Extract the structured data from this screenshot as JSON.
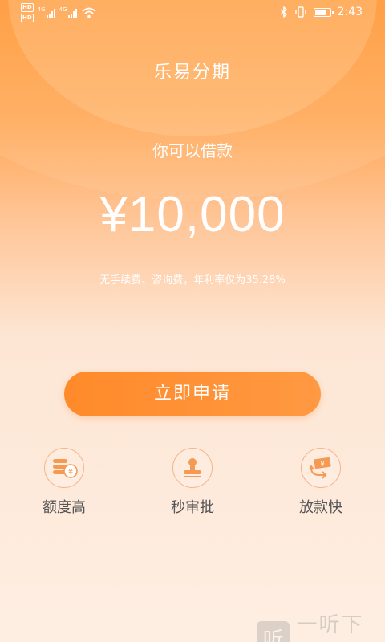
{
  "status_bar": {
    "hd_badge_1": "HD",
    "hd_badge_2": "HD",
    "signal_1_label": "4G",
    "signal_2_label": "4G",
    "time": "2:43",
    "battery_level": 0.75
  },
  "app": {
    "title": "乐易分期"
  },
  "loan": {
    "label": "你可以借款",
    "amount": "¥10,000",
    "fee_note": "无手续费、咨询费，年利率仅为35.28%"
  },
  "apply_button": {
    "label": "立即申请"
  },
  "features": [
    {
      "label": "额度高",
      "icon": "coins-icon"
    },
    {
      "label": "秒审批",
      "icon": "stamp-icon"
    },
    {
      "label": "放款快",
      "icon": "money-transfer-icon"
    }
  ],
  "watermark": {
    "glyph": "听",
    "text": "一听下载"
  },
  "colors": {
    "accent": "#ff8c2e",
    "feature_icon": "#f59a55",
    "feature_text": "#555555"
  }
}
